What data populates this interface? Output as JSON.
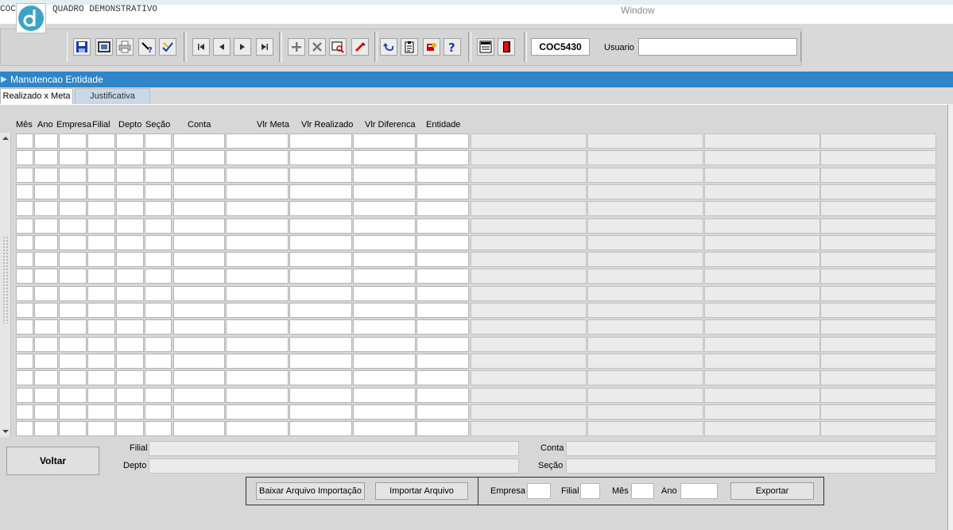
{
  "window": {
    "title": "COC5430 - QUADRO DEMONSTRATIVO",
    "menu_word": "Window"
  },
  "toolbar": {
    "form_code": "COC5430",
    "usuario_label": "Usuario",
    "usuario_value": "",
    "icons": [
      "save-icon",
      "print-preview-icon",
      "print-icon",
      "help-query-icon",
      "spell-check-icon",
      "first-record-icon",
      "prev-record-icon",
      "next-record-icon",
      "last-record-icon",
      "insert-record-icon",
      "delete-record-icon",
      "query-icon",
      "edit-icon",
      "undo-icon",
      "clipboard-icon",
      "settings-icon",
      "help-icon",
      "menu-icon",
      "exit-icon"
    ]
  },
  "panel": {
    "title": "Manutencao Entidade"
  },
  "tabs": [
    {
      "label": "Realizado x Meta",
      "active": true
    },
    {
      "label": "Justificativa",
      "active": false
    }
  ],
  "grid": {
    "columns": [
      "Mês",
      "Ano",
      "Empresa",
      "Filial",
      "Depto",
      "Seção",
      "Conta",
      "Vlr Meta",
      "Vlr Realizado",
      "Vlr Diferenca",
      "Entidade"
    ],
    "visible_rows": 18
  },
  "footer": {
    "voltar_label": "Voltar",
    "filial_label": "Filial",
    "depto_label": "Depto",
    "conta_label": "Conta",
    "secao_label": "Seção",
    "baixar_label": "Baixar Arquivo Importação",
    "importar_label": "Importar Arquivo",
    "empresa_label": "Empresa",
    "filial2_label": "Filial",
    "mes_label": "Mês",
    "ano_label": "Ano",
    "exportar_label": "Exportar"
  },
  "colors": {
    "panel_header": "#2e86c9",
    "tab_inactive": "#c9d8e6",
    "background": "#d9d9d9"
  }
}
